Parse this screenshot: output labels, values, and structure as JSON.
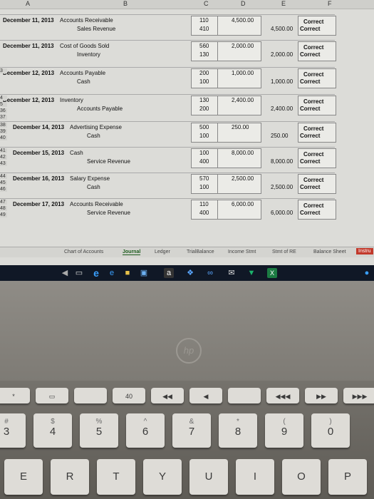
{
  "columns": [
    "A",
    "B",
    "C",
    "D",
    "E",
    "F"
  ],
  "entries": [
    {
      "date": "December 11, 2013",
      "debit_acct": "Accounts Receivable",
      "credit_acct": "Sales Revenue",
      "debit_no": "110",
      "credit_no": "410",
      "debit_amt": "4,500.00",
      "credit_amt": "4,500.00",
      "check1": "Correct",
      "check2": "Correct",
      "rows": []
    },
    {
      "date": "December 11, 2013",
      "debit_acct": "Cost of Goods Sold",
      "credit_acct": "Inventory",
      "debit_no": "560",
      "credit_no": "130",
      "debit_amt": "2,000.00",
      "credit_amt": "2,000.00",
      "check1": "Correct",
      "check2": "Correct",
      "rows": []
    },
    {
      "date": "December 12, 2013",
      "debit_acct": "Accounts Payable",
      "credit_acct": "Cash",
      "debit_no": "200",
      "credit_no": "100",
      "debit_amt": "1,000.00",
      "credit_amt": "1,000.00",
      "check1": "Correct",
      "check2": "Correct",
      "rows": [
        "3"
      ]
    },
    {
      "date": "December 12, 2013",
      "debit_acct": "Inventory",
      "credit_acct": "Accounts Payable",
      "debit_no": "130",
      "credit_no": "200",
      "debit_amt": "2,400.00",
      "credit_amt": "2,400.00",
      "check1": "Correct",
      "check2": "Correct",
      "rows": [
        "4",
        "5",
        "36",
        "37"
      ]
    },
    {
      "date": "December 14, 2013",
      "debit_acct": "Advertising Expense",
      "credit_acct": "Cash",
      "debit_no": "500",
      "credit_no": "100",
      "debit_amt": "250.00",
      "credit_amt": "250.00",
      "check1": "Correct",
      "check2": "Correct",
      "rows": [
        "38",
        "39",
        "40"
      ]
    },
    {
      "date": "December 15, 2013",
      "debit_acct": "Cash",
      "credit_acct": "Service Revenue",
      "debit_no": "100",
      "credit_no": "400",
      "debit_amt": "8,000.00",
      "credit_amt": "8,000.00",
      "check1": "Correct",
      "check2": "Correct",
      "rows": [
        "41",
        "42",
        "43"
      ]
    },
    {
      "date": "December 16, 2013",
      "debit_acct": "Salary Expense",
      "credit_acct": "Cash",
      "debit_no": "570",
      "credit_no": "100",
      "debit_amt": "2,500.00",
      "credit_amt": "2,500.00",
      "check1": "Correct",
      "check2": "Correct",
      "rows": [
        "44",
        "45",
        "46"
      ]
    },
    {
      "date": "December 17, 2013",
      "debit_acct": "Accounts Receivable",
      "credit_acct": "Service Revenue",
      "debit_no": "110",
      "credit_no": "400",
      "debit_amt": "6,000.00",
      "credit_amt": "6,000.00",
      "check1": "Correct",
      "check2": "Correct",
      "rows": [
        "47",
        "48",
        "49"
      ]
    }
  ],
  "tabs": [
    "Chart of Accounts",
    "Journal",
    "Ledger",
    "TrialBalance",
    "Income Stmt",
    "Stmt of RE",
    "Balance Sheet",
    "Instru"
  ],
  "active_tab": "Journal",
  "taskbar_icons": [
    "back-icon",
    "task-view-icon",
    "edge-icon",
    "file-explorer-icon",
    "store-icon",
    "amazon-icon",
    "dropbox-icon",
    "infinity-icon",
    "mail-icon",
    "excel-icon",
    "chrome-icon"
  ],
  "keyboard": {
    "fn_row": [
      "*",
      "▭",
      "",
      "40",
      "◀◀",
      "◀",
      "",
      "◀◀◀",
      "▶▶",
      "▶▶▶"
    ],
    "number_row": [
      {
        "top": "#",
        "main": "3"
      },
      {
        "top": "$",
        "main": "4"
      },
      {
        "top": "%",
        "main": "5"
      },
      {
        "top": "^",
        "main": "6"
      },
      {
        "top": "&",
        "main": "7"
      },
      {
        "top": "*",
        "main": "8"
      },
      {
        "top": "(",
        "main": "9"
      },
      {
        "top": ")",
        "main": "0"
      }
    ],
    "letter_row": [
      "E",
      "R",
      "T",
      "Y",
      "U",
      "I",
      "O",
      "P"
    ]
  },
  "logo_text": "hp",
  "colors": {
    "correct": "#1a1a1a",
    "active_tab": "#1c5c1c",
    "instr_tab": "#c2392b",
    "taskbar": "#101826"
  }
}
